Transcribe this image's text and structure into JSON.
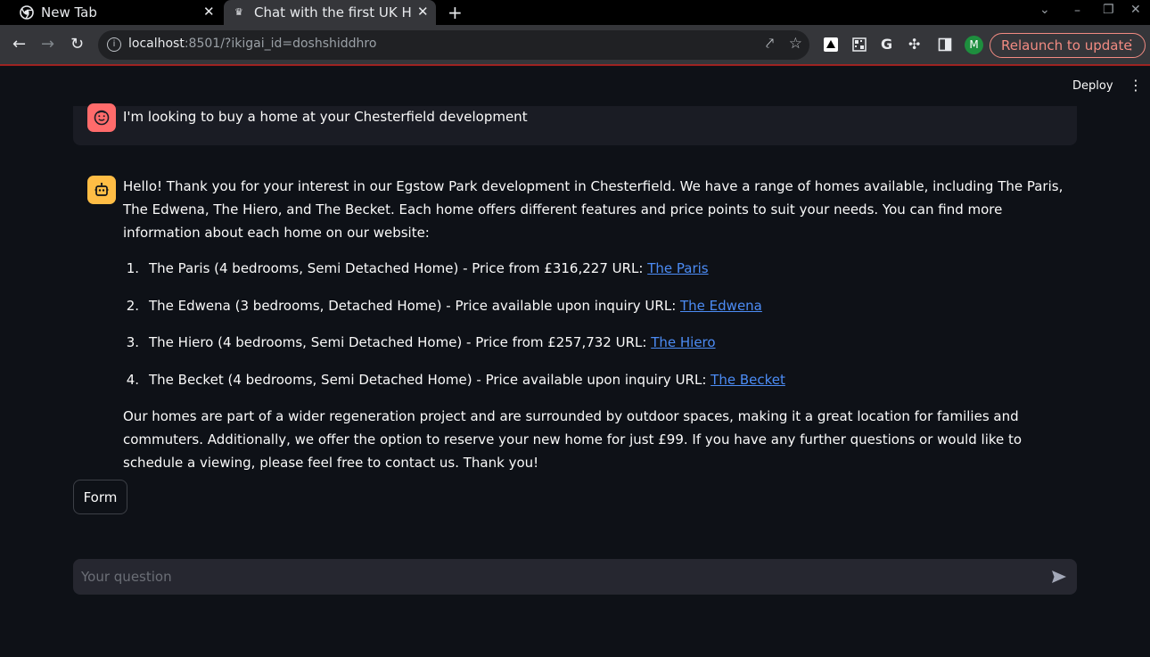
{
  "browser": {
    "tabs": [
      {
        "title": "New Tab",
        "icon": "chrome-icon"
      },
      {
        "title": "Chat with the first UK House",
        "icon": "crown-icon"
      }
    ],
    "new_tab_label": "+",
    "url_host": "localhost",
    "url_rest": ":8501/?ikigai_id=doshshiddhro",
    "profile_initial": "M",
    "relaunch_label": "Relaunch to update"
  },
  "app": {
    "deploy_label": "Deploy",
    "user_message": "I'm looking to buy a home at your Chesterfield development",
    "bot_intro": "Hello! Thank you for your interest in our Egstow Park development in Chesterfield. We have a range of homes available, including The Paris, The Edwena, The Hiero, and The Becket. Each home offers different features and price points to suit your needs. You can find more information about each home on our website:",
    "homes": [
      {
        "num": "1.",
        "text": "The Paris (4 bedrooms, Semi Detached Home) - Price from £316,227 URL: ",
        "link": "The Paris"
      },
      {
        "num": "2.",
        "text": "The Edwena (3 bedrooms, Detached Home) - Price available upon inquiry URL: ",
        "link": "The Edwena"
      },
      {
        "num": "3.",
        "text": "The Hiero (4 bedrooms, Semi Detached Home) - Price from £257,732 URL: ",
        "link": "The Hiero"
      },
      {
        "num": "4.",
        "text": "The Becket (4 bedrooms, Semi Detached Home) - Price available upon inquiry URL: ",
        "link": "The Becket"
      }
    ],
    "bot_outro": "Our homes are part of a wider regeneration project and are surrounded by outdoor spaces, making it a great location for families and commuters. Additionally, we offer the option to reserve your new home for just £99. If you have any further questions or would like to schedule a viewing, please feel free to contact us. Thank you!",
    "form_button": "Form",
    "input_placeholder": "Your question"
  },
  "colors": {
    "background": "#0e1117",
    "user_avatar": "#ff6b6b",
    "bot_avatar": "#ffbd45",
    "link": "#4c8cf5",
    "relaunch": "#f28b82"
  }
}
